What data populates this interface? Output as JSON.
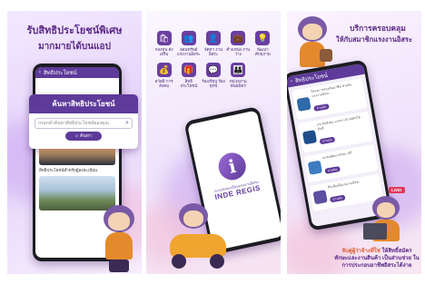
{
  "panel1": {
    "title": "รับสิทธิประโยชน์พิเศษ",
    "subtitle": "มากมายได้บนแอป",
    "app_bar_title": "สิทธิประโยชน์",
    "search_card": {
      "header": "ค้นหาสิทธิประโยชน์",
      "placeholder": "กรอกคำค้นหาสิทธิประโยชน์ของคุณ",
      "button": "ค้นหา"
    },
    "news_caption": "สิทธิประโยชน์สำหรับผู้ลงทะเบียน"
  },
  "panel2": {
    "menu": [
      {
        "icon": "bag-icon",
        "glyph": "🛍",
        "label": "กองทุน ส่งเสริม"
      },
      {
        "icon": "people-icon",
        "glyph": "👥",
        "label": "ออมทรัพย์ แรงงานอิสระ"
      },
      {
        "icon": "person-icon",
        "glyph": "👤",
        "label": "จัดหา งานอิสระ"
      },
      {
        "icon": "briefcase-icon",
        "glyph": "💼",
        "label": "ตำแหน่ง งานว่าง"
      },
      {
        "icon": "lightbulb-icon",
        "glyph": "💡",
        "label": "พัฒนา ศักยภาพ"
      },
      {
        "icon": "wallet-icon",
        "glyph": "💰",
        "label": "สวัสดิ การสังคม"
      },
      {
        "icon": "gift-icon",
        "glyph": "🎁",
        "label": "สิทธิ ประโยชน์"
      },
      {
        "icon": "chat-icon",
        "glyph": "💬",
        "label": "ร้องเรียน ร้องทุกข์"
      },
      {
        "icon": "group-icon",
        "glyph": "👪",
        "label": "หน่วยงาน พันธมิตร"
      }
    ],
    "logo_letter": "i",
    "logo_subtitle": "ระบบลงทะเบียนแรงงานอิสระ",
    "logo_text": "INDE REGIS"
  },
  "panel3": {
    "title": "บริการครอบคลุม",
    "subtitle": "ให้กับสมาชิกแรงงานอิสระ",
    "screen_header": "สิทธิประโยชน์",
    "cards": [
      {
        "text": "โครงการส่งเสริมอาชีพ สำหรับแรงงานอิสระ",
        "button": "อ่านต่อ"
      },
      {
        "text": "ประกันสังคม มาตรา 40 สมัครได้ทันที",
        "button": "อ่านต่อ"
      },
      {
        "text": "อบรมพัฒนาทักษะ ฟรี",
        "button": "อ่านต่อ"
      },
      {
        "text": "สินเชื่อเพื่อแรงงานอิสระ",
        "button": "อ่านต่อ"
      }
    ],
    "live_badge": "LIVE!",
    "bottom_text_1": "จับคู่ผู้ว่าจ้างที่ใช่",
    "bottom_text_2": "ให้สิทธิ์สมัคร",
    "bottom_text_3": "ทักษะและงานสินค้า เป็นส่วนช่วย ในการประกอบอาชีพอิสระได้ง่าย"
  },
  "colors": {
    "brand_purple": "#5e3a9a",
    "accent_orange": "#e58a2c"
  }
}
